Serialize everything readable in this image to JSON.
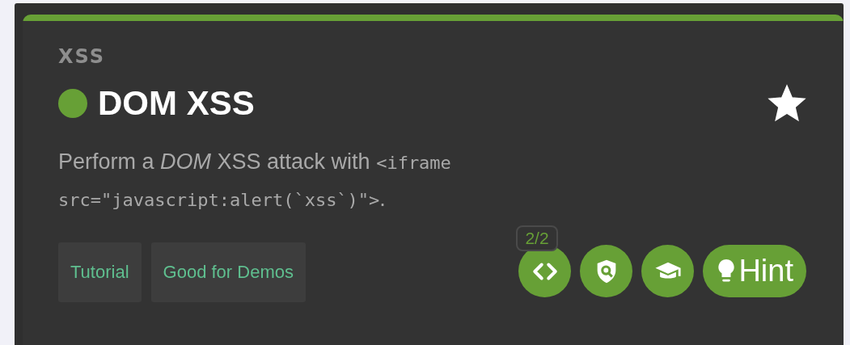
{
  "category": "XSS",
  "challenge": {
    "title": "DOM XSS",
    "solved": true,
    "starred": true
  },
  "description": {
    "text": "Perform a *DOM* XSS attack with ",
    "code": "<iframe src=\"javascript:alert(`xss`)\">",
    "end": "."
  },
  "tags": [
    "Tutorial",
    "Good for Demos"
  ],
  "actions": [
    {
      "kind": "code",
      "badge": "2/2"
    },
    {
      "kind": "shield"
    },
    {
      "kind": "tutorial"
    },
    {
      "kind": "hint",
      "label": "Hint"
    }
  ]
}
